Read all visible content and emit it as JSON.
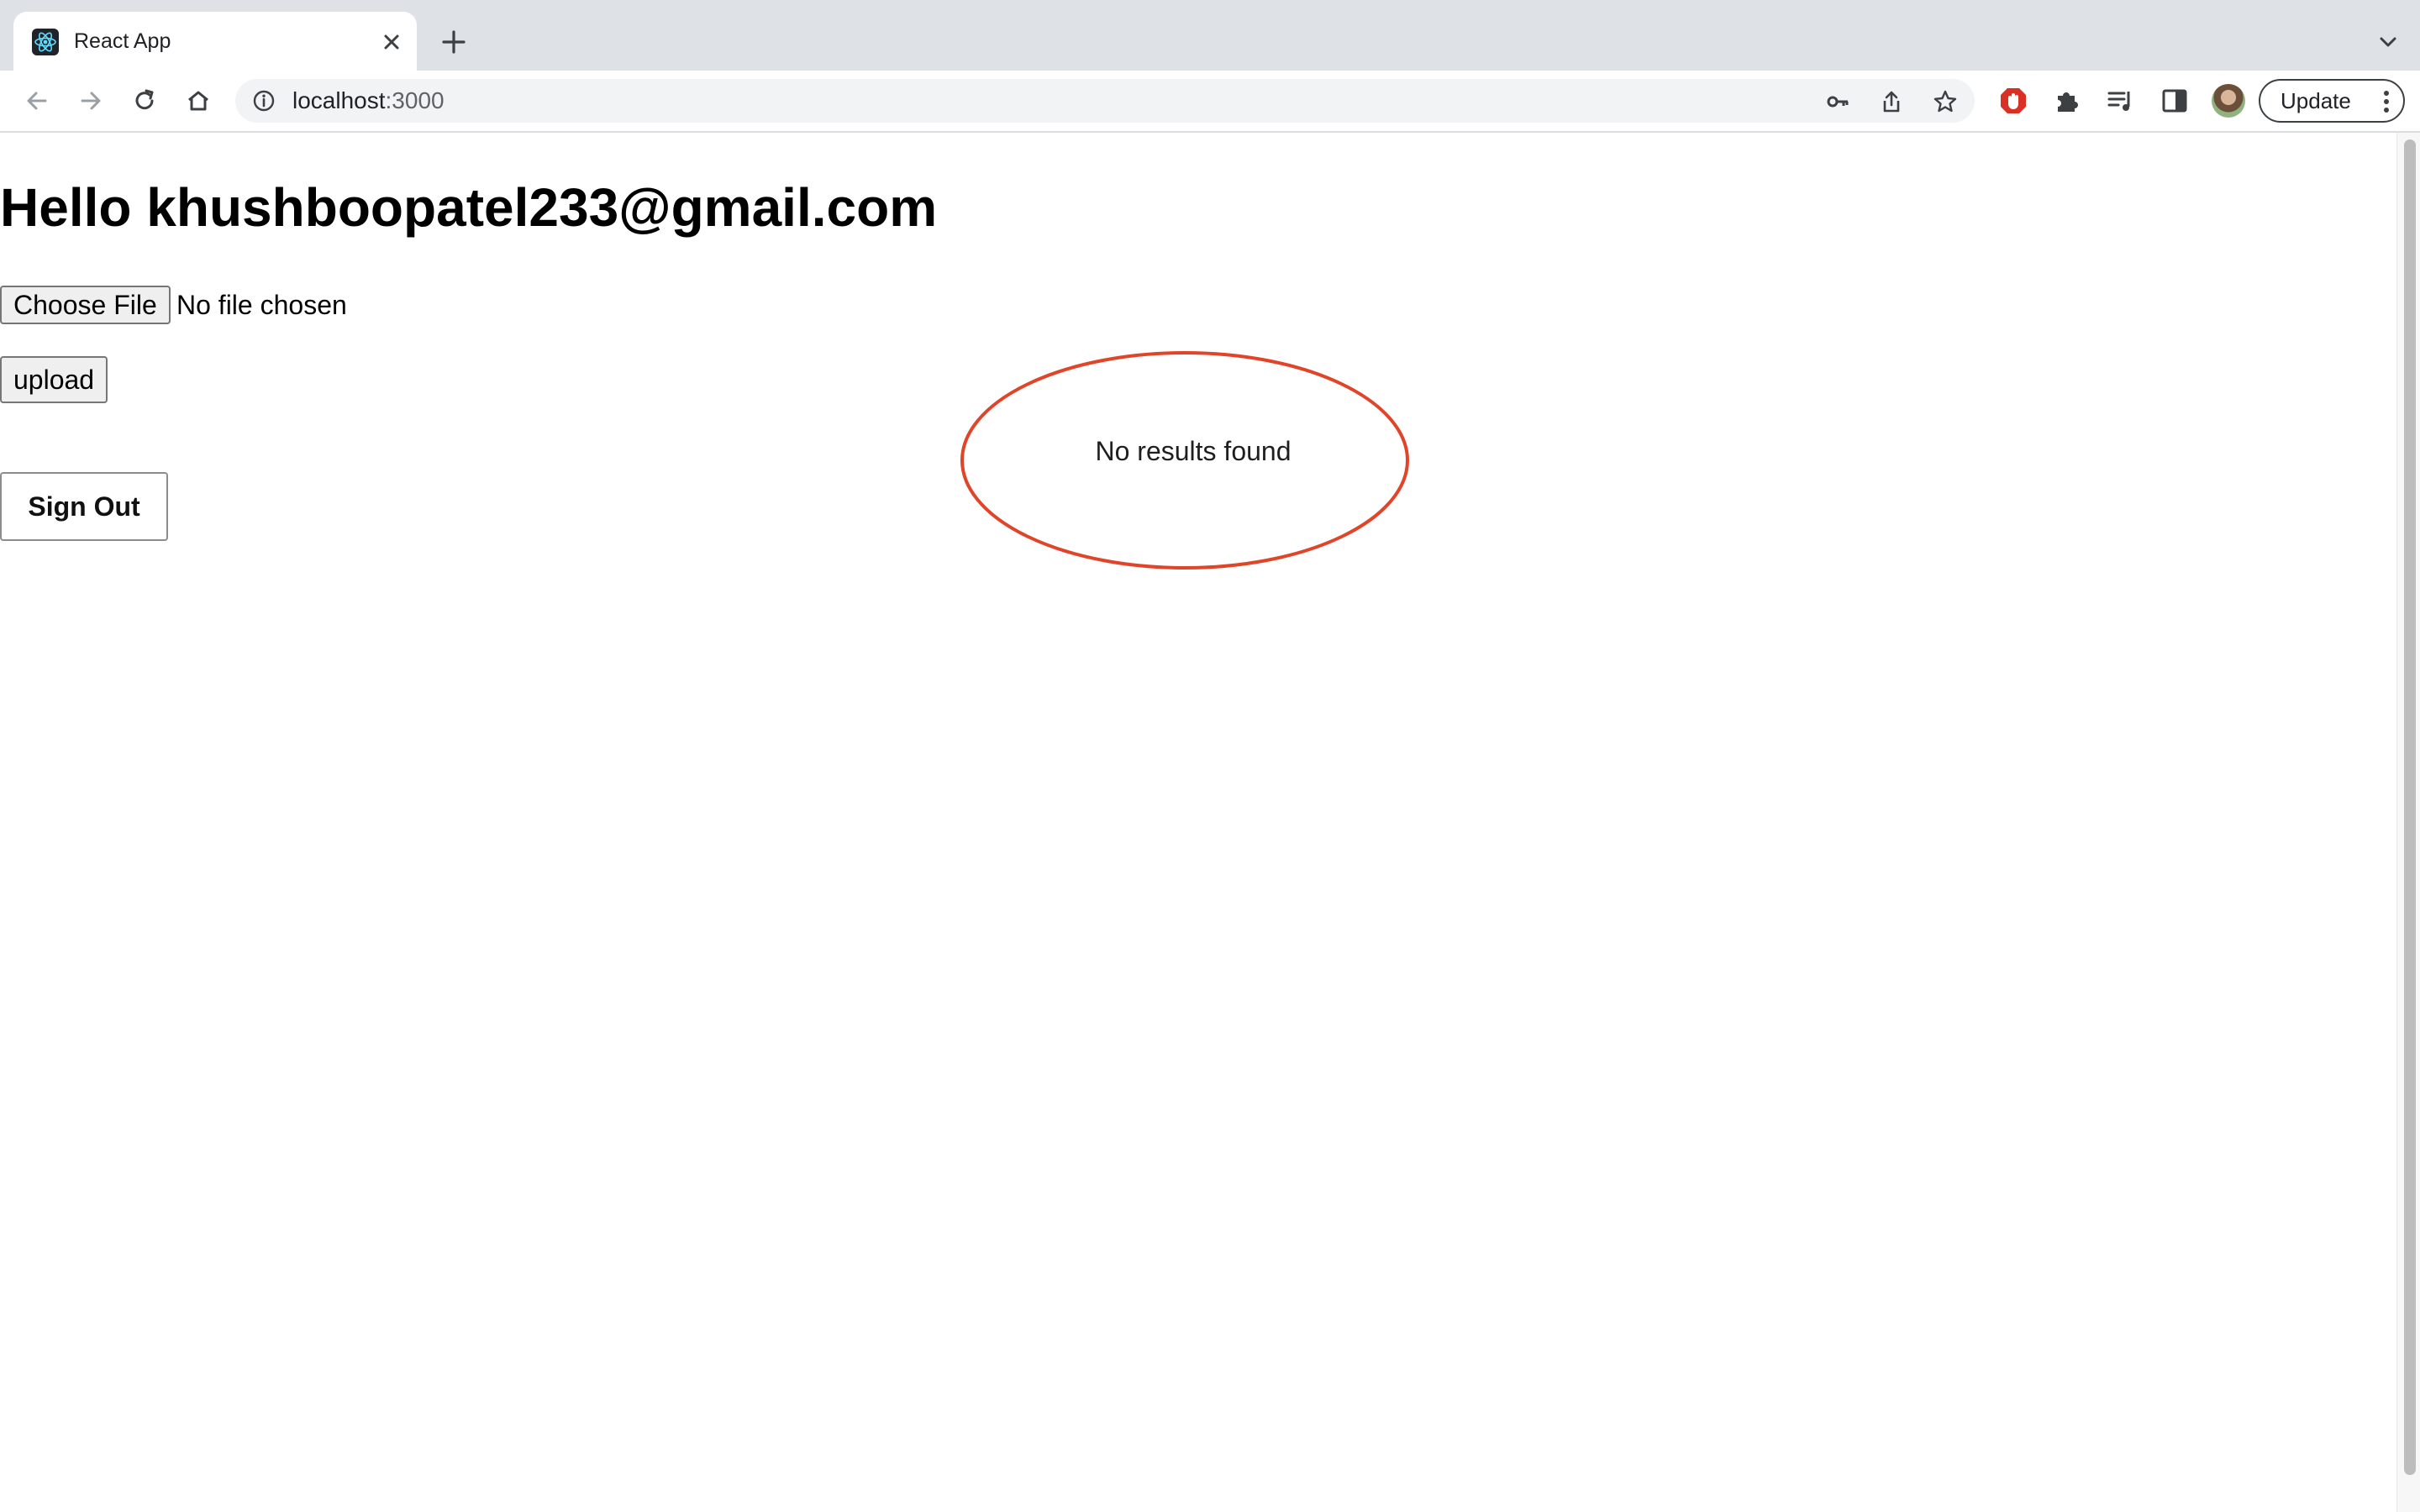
{
  "browser": {
    "tab": {
      "title": "React App",
      "favicon": "react-icon"
    },
    "address": {
      "host": "localhost",
      "port": ":3000"
    },
    "update_label": "Update",
    "icons": [
      "back-icon",
      "forward-icon",
      "reload-icon",
      "home-icon",
      "info-icon",
      "key-icon",
      "share-icon",
      "star-icon",
      "adblock-icon",
      "puzzle-icon",
      "media-icon",
      "sidepanel-icon",
      "profile-avatar",
      "kebab-icon",
      "tab-close-icon",
      "new-tab-icon",
      "tab-list-icon"
    ]
  },
  "page": {
    "greeting": "Hello khushboopatel233@gmail.com",
    "file_input": {
      "button_label": "Choose File",
      "status": "No file chosen"
    },
    "upload_label": "upload",
    "signout_label": "Sign Out",
    "results_text": "No results found",
    "annotation_color": "#e0452a"
  }
}
